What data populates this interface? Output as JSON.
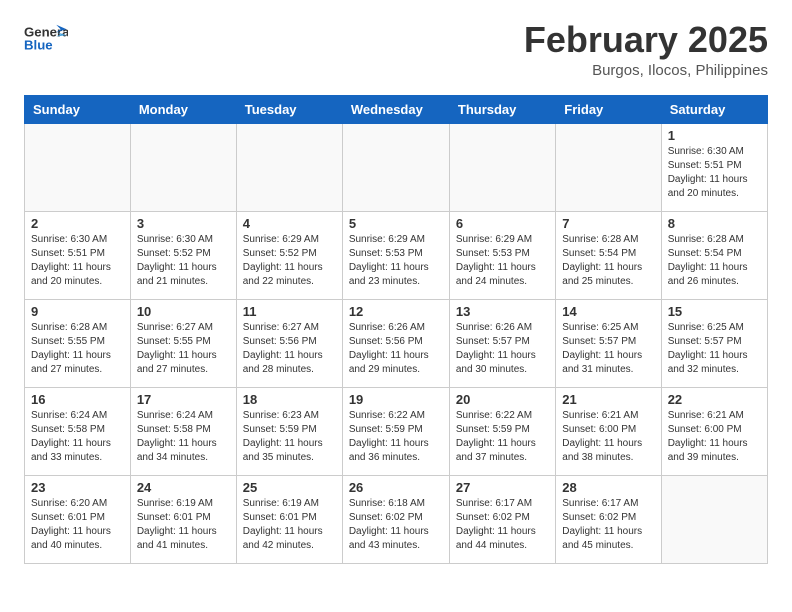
{
  "header": {
    "logo_general": "General",
    "logo_blue": "Blue",
    "month_year": "February 2025",
    "location": "Burgos, Ilocos, Philippines"
  },
  "weekdays": [
    "Sunday",
    "Monday",
    "Tuesday",
    "Wednesday",
    "Thursday",
    "Friday",
    "Saturday"
  ],
  "weeks": [
    [
      {
        "day": "",
        "info": ""
      },
      {
        "day": "",
        "info": ""
      },
      {
        "day": "",
        "info": ""
      },
      {
        "day": "",
        "info": ""
      },
      {
        "day": "",
        "info": ""
      },
      {
        "day": "",
        "info": ""
      },
      {
        "day": "1",
        "info": "Sunrise: 6:30 AM\nSunset: 5:51 PM\nDaylight: 11 hours\nand 20 minutes."
      }
    ],
    [
      {
        "day": "2",
        "info": "Sunrise: 6:30 AM\nSunset: 5:51 PM\nDaylight: 11 hours\nand 20 minutes."
      },
      {
        "day": "3",
        "info": "Sunrise: 6:30 AM\nSunset: 5:52 PM\nDaylight: 11 hours\nand 21 minutes."
      },
      {
        "day": "4",
        "info": "Sunrise: 6:29 AM\nSunset: 5:52 PM\nDaylight: 11 hours\nand 22 minutes."
      },
      {
        "day": "5",
        "info": "Sunrise: 6:29 AM\nSunset: 5:53 PM\nDaylight: 11 hours\nand 23 minutes."
      },
      {
        "day": "6",
        "info": "Sunrise: 6:29 AM\nSunset: 5:53 PM\nDaylight: 11 hours\nand 24 minutes."
      },
      {
        "day": "7",
        "info": "Sunrise: 6:28 AM\nSunset: 5:54 PM\nDaylight: 11 hours\nand 25 minutes."
      },
      {
        "day": "8",
        "info": "Sunrise: 6:28 AM\nSunset: 5:54 PM\nDaylight: 11 hours\nand 26 minutes."
      }
    ],
    [
      {
        "day": "9",
        "info": "Sunrise: 6:28 AM\nSunset: 5:55 PM\nDaylight: 11 hours\nand 27 minutes."
      },
      {
        "day": "10",
        "info": "Sunrise: 6:27 AM\nSunset: 5:55 PM\nDaylight: 11 hours\nand 27 minutes."
      },
      {
        "day": "11",
        "info": "Sunrise: 6:27 AM\nSunset: 5:56 PM\nDaylight: 11 hours\nand 28 minutes."
      },
      {
        "day": "12",
        "info": "Sunrise: 6:26 AM\nSunset: 5:56 PM\nDaylight: 11 hours\nand 29 minutes."
      },
      {
        "day": "13",
        "info": "Sunrise: 6:26 AM\nSunset: 5:57 PM\nDaylight: 11 hours\nand 30 minutes."
      },
      {
        "day": "14",
        "info": "Sunrise: 6:25 AM\nSunset: 5:57 PM\nDaylight: 11 hours\nand 31 minutes."
      },
      {
        "day": "15",
        "info": "Sunrise: 6:25 AM\nSunset: 5:57 PM\nDaylight: 11 hours\nand 32 minutes."
      }
    ],
    [
      {
        "day": "16",
        "info": "Sunrise: 6:24 AM\nSunset: 5:58 PM\nDaylight: 11 hours\nand 33 minutes."
      },
      {
        "day": "17",
        "info": "Sunrise: 6:24 AM\nSunset: 5:58 PM\nDaylight: 11 hours\nand 34 minutes."
      },
      {
        "day": "18",
        "info": "Sunrise: 6:23 AM\nSunset: 5:59 PM\nDaylight: 11 hours\nand 35 minutes."
      },
      {
        "day": "19",
        "info": "Sunrise: 6:22 AM\nSunset: 5:59 PM\nDaylight: 11 hours\nand 36 minutes."
      },
      {
        "day": "20",
        "info": "Sunrise: 6:22 AM\nSunset: 5:59 PM\nDaylight: 11 hours\nand 37 minutes."
      },
      {
        "day": "21",
        "info": "Sunrise: 6:21 AM\nSunset: 6:00 PM\nDaylight: 11 hours\nand 38 minutes."
      },
      {
        "day": "22",
        "info": "Sunrise: 6:21 AM\nSunset: 6:00 PM\nDaylight: 11 hours\nand 39 minutes."
      }
    ],
    [
      {
        "day": "23",
        "info": "Sunrise: 6:20 AM\nSunset: 6:01 PM\nDaylight: 11 hours\nand 40 minutes."
      },
      {
        "day": "24",
        "info": "Sunrise: 6:19 AM\nSunset: 6:01 PM\nDaylight: 11 hours\nand 41 minutes."
      },
      {
        "day": "25",
        "info": "Sunrise: 6:19 AM\nSunset: 6:01 PM\nDaylight: 11 hours\nand 42 minutes."
      },
      {
        "day": "26",
        "info": "Sunrise: 6:18 AM\nSunset: 6:02 PM\nDaylight: 11 hours\nand 43 minutes."
      },
      {
        "day": "27",
        "info": "Sunrise: 6:17 AM\nSunset: 6:02 PM\nDaylight: 11 hours\nand 44 minutes."
      },
      {
        "day": "28",
        "info": "Sunrise: 6:17 AM\nSunset: 6:02 PM\nDaylight: 11 hours\nand 45 minutes."
      },
      {
        "day": "",
        "info": ""
      }
    ]
  ]
}
